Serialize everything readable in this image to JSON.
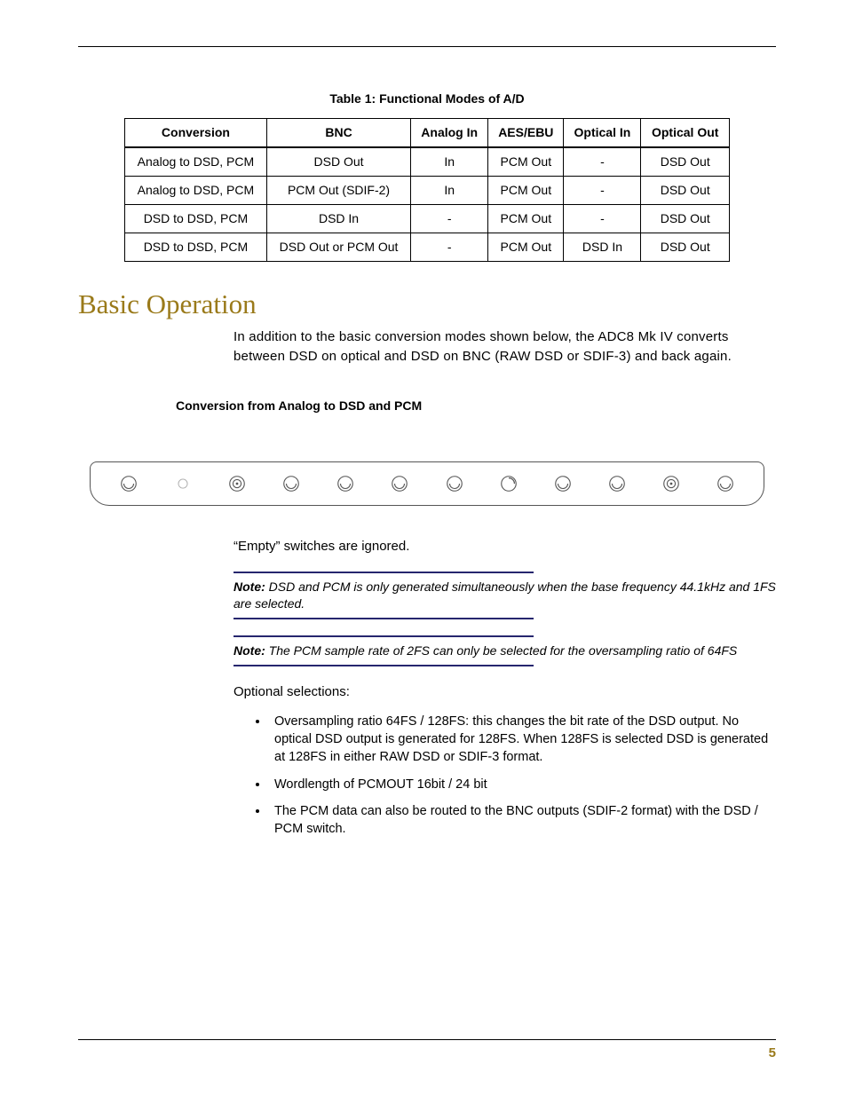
{
  "table": {
    "caption_label": "Table 1:",
    "caption_title": "Functional Modes of A/D",
    "headers": [
      "Conversion",
      "BNC",
      "Analog In",
      "AES/EBU",
      "Optical In",
      "Optical Out"
    ],
    "rows": [
      [
        "Analog to DSD, PCM",
        "DSD Out",
        "In",
        "PCM Out",
        "-",
        "DSD Out"
      ],
      [
        "Analog to DSD, PCM",
        "PCM Out (SDIF-2)",
        "In",
        "PCM Out",
        "-",
        "DSD Out"
      ],
      [
        "DSD to DSD, PCM",
        "DSD In",
        "-",
        "PCM Out",
        "-",
        "DSD Out"
      ],
      [
        "DSD to DSD, PCM",
        "DSD Out or PCM Out",
        "-",
        "PCM Out",
        "DSD In",
        "DSD Out"
      ]
    ]
  },
  "section_heading": "Basic Operation",
  "intro_paragraph": "In addition to the basic conversion modes shown below, the ADC8 Mk IV converts between DSD on optical and DSD on BNC (RAW DSD or SDIF-3) and back again.",
  "sub_heading": "Conversion from Analog to DSD and PCM",
  "panel_knobs": [
    "bnc-icon",
    "empty-icon",
    "target-icon",
    "bnc-icon",
    "bnc-icon",
    "bnc-icon",
    "bnc-icon",
    "arc-icon",
    "bnc-icon",
    "bnc-icon",
    "target-icon",
    "bnc-icon"
  ],
  "empty_text": "“Empty” switches are ignored.",
  "notes": [
    {
      "label": "Note:",
      "text": "DSD and PCM is only generated simultaneously when the base frequency 44.1kHz and 1FS are selected."
    },
    {
      "label": "Note:",
      "text": "The PCM sample rate of 2FS can only be selected for the oversampling ratio of 64FS"
    }
  ],
  "optional_heading": "Optional selections:",
  "options": [
    "Oversampling ratio 64FS / 128FS: this changes the bit rate of the DSD output. No optical DSD output is generated for 128FS. When 128FS is selected DSD is generated at 128FS in either RAW DSD or SDIF-3 format.",
    "Wordlength of PCMOUT 16bit / 24 bit",
    "The PCM data can also be routed to the BNC outputs (SDIF-2 format) with the DSD / PCM switch."
  ],
  "page_number": "5"
}
